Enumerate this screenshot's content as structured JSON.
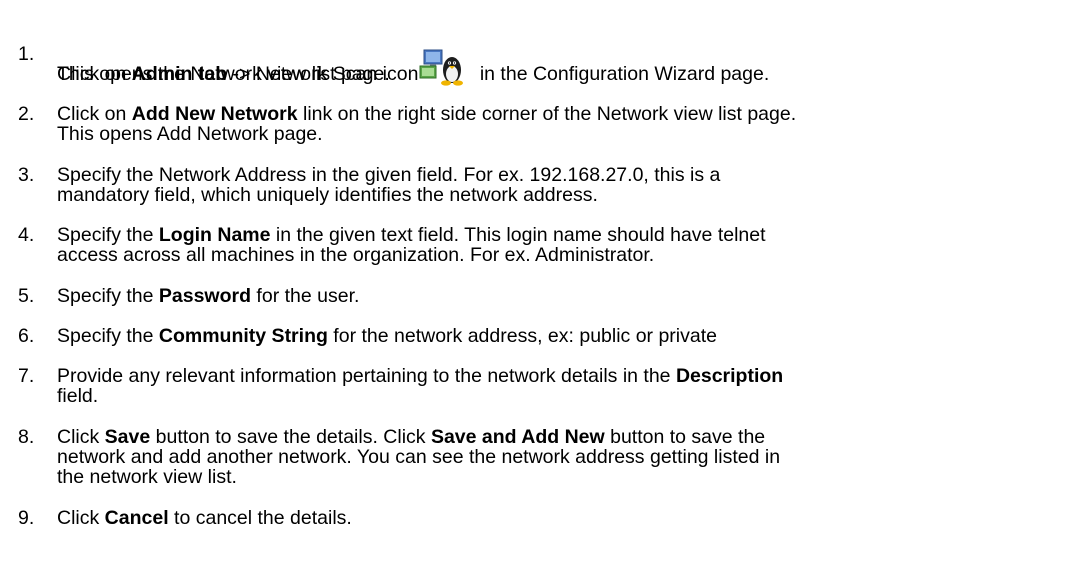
{
  "steps": [
    {
      "number": "1.",
      "parts": [
        {
          "t": "Click on ",
          "b": false
        },
        {
          "t": "Admin tab",
          "b": true
        },
        {
          "t": " -> Network Scan icon",
          "b": false
        },
        {
          "icon": "network-scan-icon"
        },
        {
          "t": " in the Configuration Wizard page.",
          "b": false
        }
      ],
      "wrap": "This opens the Network view list page."
    },
    {
      "number": "2.",
      "parts": [
        {
          "t": "Click on ",
          "b": false
        },
        {
          "t": "Add New Network",
          "b": true
        },
        {
          "t": " link on the right side corner of the Network view list page.",
          "b": false
        }
      ],
      "wrap": "This opens Add Network page."
    },
    {
      "number": "3.",
      "parts": [
        {
          "t": "Specify the Network Address in the given field. For ex. 192.168.27.0, this is a",
          "b": false
        }
      ],
      "wrap": "mandatory field, which uniquely identifies the network address."
    },
    {
      "number": "4.",
      "parts": [
        {
          "t": "Specify the ",
          "b": false
        },
        {
          "t": "Login Name",
          "b": true
        },
        {
          "t": " in the given text field. This login name should have telnet",
          "b": false
        }
      ],
      "wrap": "access across all machines in the organization. For ex. Administrator."
    },
    {
      "number": "5.",
      "parts": [
        {
          "t": "Specify the ",
          "b": false
        },
        {
          "t": "Password",
          "b": true
        },
        {
          "t": " for the user.",
          "b": false
        }
      ],
      "wrap": ""
    },
    {
      "number": "6.",
      "parts": [
        {
          "t": "Specify the ",
          "b": false
        },
        {
          "t": "Community String",
          "b": true
        },
        {
          "t": " for the network address, ex: public or private",
          "b": false
        }
      ],
      "wrap": ""
    },
    {
      "number": "7.",
      "parts": [
        {
          "t": "Provide any relevant information pertaining to the network details in the ",
          "b": false
        },
        {
          "t": "Description",
          "b": true
        }
      ],
      "wrap": "field."
    },
    {
      "number": "8.",
      "parts": [
        {
          "t": "Click ",
          "b": false
        },
        {
          "t": "Save",
          "b": true
        },
        {
          "t": " button to save the details. Click ",
          "b": false
        },
        {
          "t": "Save and Add New",
          "b": true
        },
        {
          "t": " button to save the",
          "b": false
        }
      ],
      "wrap": "network and add another network. You can see the network address getting listed in",
      "wrap2": "the network view list."
    },
    {
      "number": "9.",
      "parts": [
        {
          "t": "Click ",
          "b": false
        },
        {
          "t": "Cancel",
          "b": true
        },
        {
          "t": " to cancel the details.",
          "b": false
        }
      ],
      "wrap": ""
    }
  ]
}
